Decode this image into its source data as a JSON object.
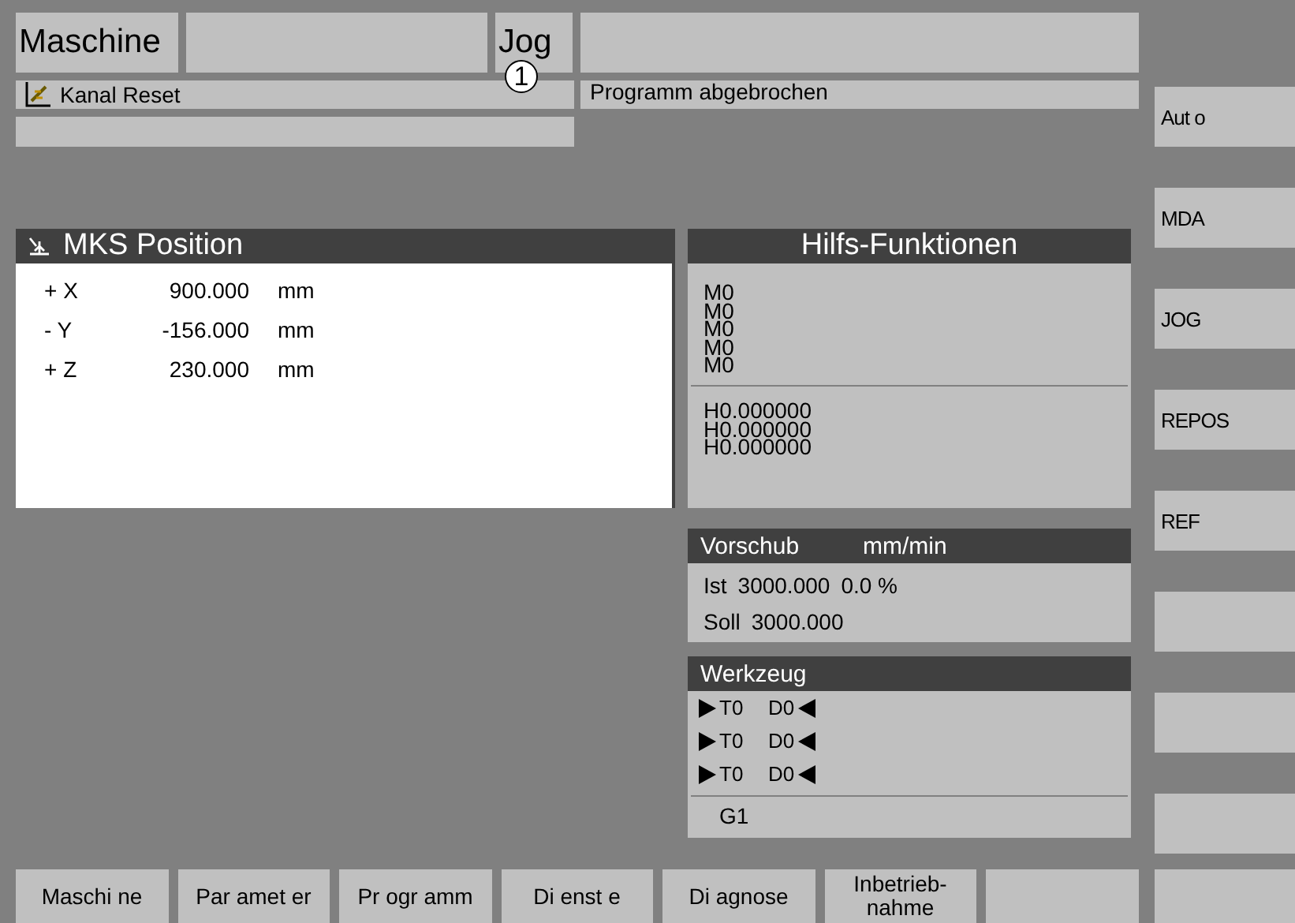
{
  "header": {
    "area": "Maschine",
    "mode": "Jog",
    "channel_number": "1"
  },
  "channel_status": "Kanal Reset",
  "program_status": "Programm abgebrochen",
  "position": {
    "title": "MKS  Position",
    "axes": [
      {
        "axis": "+ X",
        "value": "900.000",
        "unit": "mm"
      },
      {
        "axis": "- Y",
        "value": "-156.000",
        "unit": "mm"
      },
      {
        "axis": "+ Z",
        "value": "230.000",
        "unit": "mm"
      }
    ]
  },
  "aux_functions": {
    "title": "Hilfs-Funktionen",
    "m_functions": [
      "M0",
      "M0",
      "M0",
      "M0",
      "M0"
    ],
    "h_functions": [
      "H0.000000",
      "H0.000000",
      "H0.000000"
    ]
  },
  "feed": {
    "title": "Vorschub",
    "unit": "mm/min",
    "rows": [
      {
        "label": "Ist",
        "value": "3000.000",
        "override": "0.0 %"
      },
      {
        "label": "Soll",
        "value": "3000.000"
      }
    ]
  },
  "tool": {
    "title": "Werkzeug",
    "rows": [
      {
        "tool": "T0",
        "offset": "D0"
      },
      {
        "tool": "T0",
        "offset": "D0"
      },
      {
        "tool": "T0",
        "offset": "D0"
      }
    ],
    "g_function": "G1"
  },
  "mode_softkeys": [
    "Aut o",
    "MDA",
    "JOG",
    "REPOS",
    "REF"
  ],
  "area_softkeys": [
    "Maschi ne",
    "Par amet er",
    "Pr ogr amm",
    "Di enst e",
    "Di agnose",
    "Inbetrieb-\nnahme"
  ]
}
